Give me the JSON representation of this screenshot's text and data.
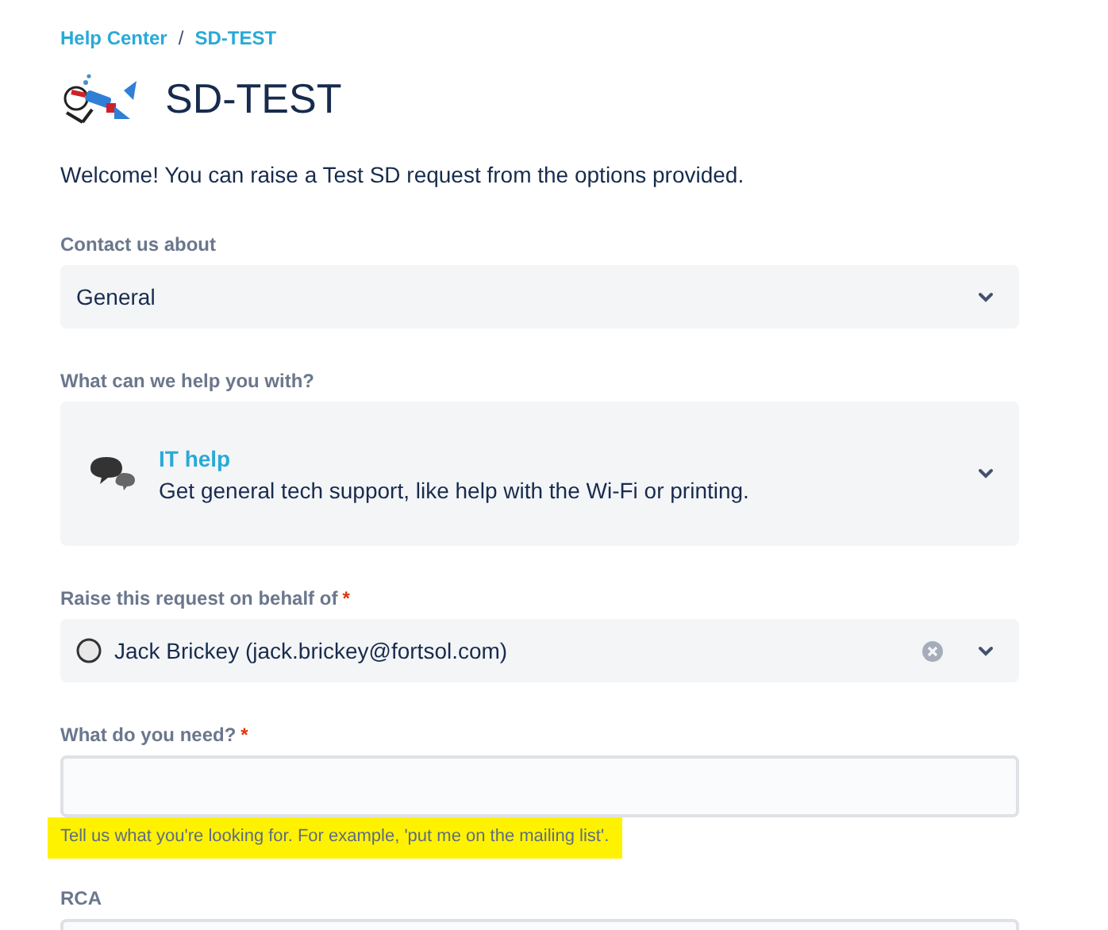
{
  "breadcrumb": [
    {
      "label": "Help Center"
    },
    {
      "label": "SD-TEST"
    }
  ],
  "breadcrumb_separator": "/",
  "title": "SD-TEST",
  "welcome": "Welcome! You can raise a Test SD request from the options provided.",
  "fields": [
    {
      "kind": "select",
      "label": "Contact us about",
      "value": "General"
    },
    {
      "kind": "request_type",
      "label": "What can we help you with?",
      "type_name": "IT help",
      "description": "Get general tech support, like help with the Wi-Fi or printing."
    },
    {
      "kind": "user",
      "label": "Raise this request on behalf of",
      "required_mark": "*",
      "value": "Jack Brickey (jack.brickey@fortsol.com)"
    },
    {
      "kind": "text",
      "label": "What do you need?",
      "required_mark": "*",
      "help": "Tell us what you're looking for. For example, 'put me on the mailing list'."
    },
    {
      "kind": "text",
      "label": "RCA"
    }
  ]
}
